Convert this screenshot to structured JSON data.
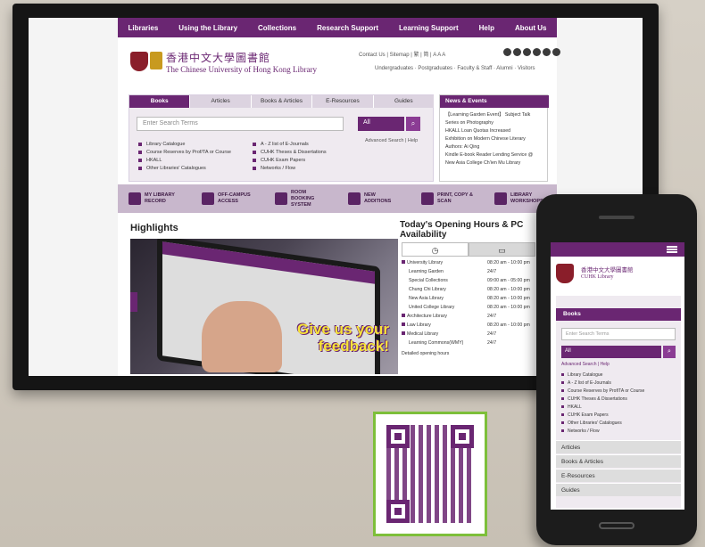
{
  "desktop": {
    "nav": [
      "Libraries",
      "Using the Library",
      "Collections",
      "Research Support",
      "Learning Support",
      "Help",
      "About Us"
    ],
    "title_zh": "香港中文大學圖書館",
    "title_en": "The Chinese University of Hong Kong Library",
    "utility": "Contact Us  |  Sitemap  |  繁  |  简  |  A  A  A",
    "audiences": "Undergraduates  ·  Postgraduates  ·  Faculty & Staff  ·  Alumni  ·  Visitors",
    "search_tabs": [
      "Books",
      "Articles",
      "Books & Articles",
      "E-Resources",
      "Guides"
    ],
    "search_placeholder": "Enter Search Terms",
    "search_select": "All",
    "advanced": "Advanced Search | Help",
    "links": [
      "Library Catalogue",
      "Course Reserves by Prof/TA or Course",
      "HKALL",
      "Other Libraries' Catalogues",
      "A - Z list of E-Journals",
      "CUHK Theses & Dissertations",
      "CUHK Exam Papers",
      "Networks / Flow"
    ],
    "news_title": "News & Events",
    "news": [
      "【Learning Garden Event】 Subject Talk Series on Photography",
      "HKALL Loan Quotas Increased",
      "Exhibition on Modern Chinese Literary Authors: Ai Qing",
      "Kindle E-book Reader Lending Service @ New Asia College Ch'ien Mu Library"
    ],
    "quick": [
      "MY LIBRARY RECORD",
      "OFF-CAMPUS ACCESS",
      "ROOM BOOKING SYSTEM",
      "NEW ADDITIONS",
      "PRINT, COPY & SCAN",
      "LIBRARY WORKSHOPS"
    ],
    "highlights": "Highlights",
    "slide_text": "Give us your feedback!",
    "hours_title": "Today's Opening Hours & PC Availability",
    "hours": [
      {
        "name": "University Library",
        "time": "08:20 am - 10:00 pm",
        "main": true
      },
      {
        "name": "Learning Garden",
        "time": "24/7",
        "main": false
      },
      {
        "name": "Special Collections",
        "time": "09:00 am - 05:00 pm",
        "main": false
      },
      {
        "name": "Chung Chi Library",
        "time": "08:20 am - 10:00 pm",
        "main": false
      },
      {
        "name": "New Asia Library",
        "time": "08:20 am - 10:00 pm",
        "main": false
      },
      {
        "name": "United College Library",
        "time": "08:20 am - 10:00 pm",
        "main": false
      },
      {
        "name": "Architecture Library",
        "time": "24/7",
        "main": true
      },
      {
        "name": "Law Library",
        "time": "08:20 am - 10:00 pm",
        "main": true
      },
      {
        "name": "Medical Library",
        "time": "24/7",
        "main": true
      },
      {
        "name": "Learning Commons(WMY)",
        "time": "24/7",
        "main": false
      }
    ],
    "hours_more": "Detailed opening hours"
  },
  "phone": {
    "title_zh": "香港中文大學圖書館",
    "title_en": "CUHK Library",
    "tab": "Books",
    "placeholder": "Enter Search Terms",
    "select": "All",
    "advanced": "Advanced Search | Help",
    "links": [
      "Library Catalogue",
      "A - Z list of E-Journals",
      "Course Reserves by Prof/TA or Course",
      "CUHK Theses & Dissertations",
      "HKALL",
      "CUHK Exam Papers",
      "Other Libraries' Catalogues",
      "Networks / Flow"
    ],
    "accordion": [
      "Articles",
      "Books & Articles",
      "E-Resources",
      "Guides"
    ]
  },
  "colors": {
    "brand": "#6a2672",
    "qr_frame": "#7dbf3a",
    "slide_text": "#f7e43a"
  }
}
